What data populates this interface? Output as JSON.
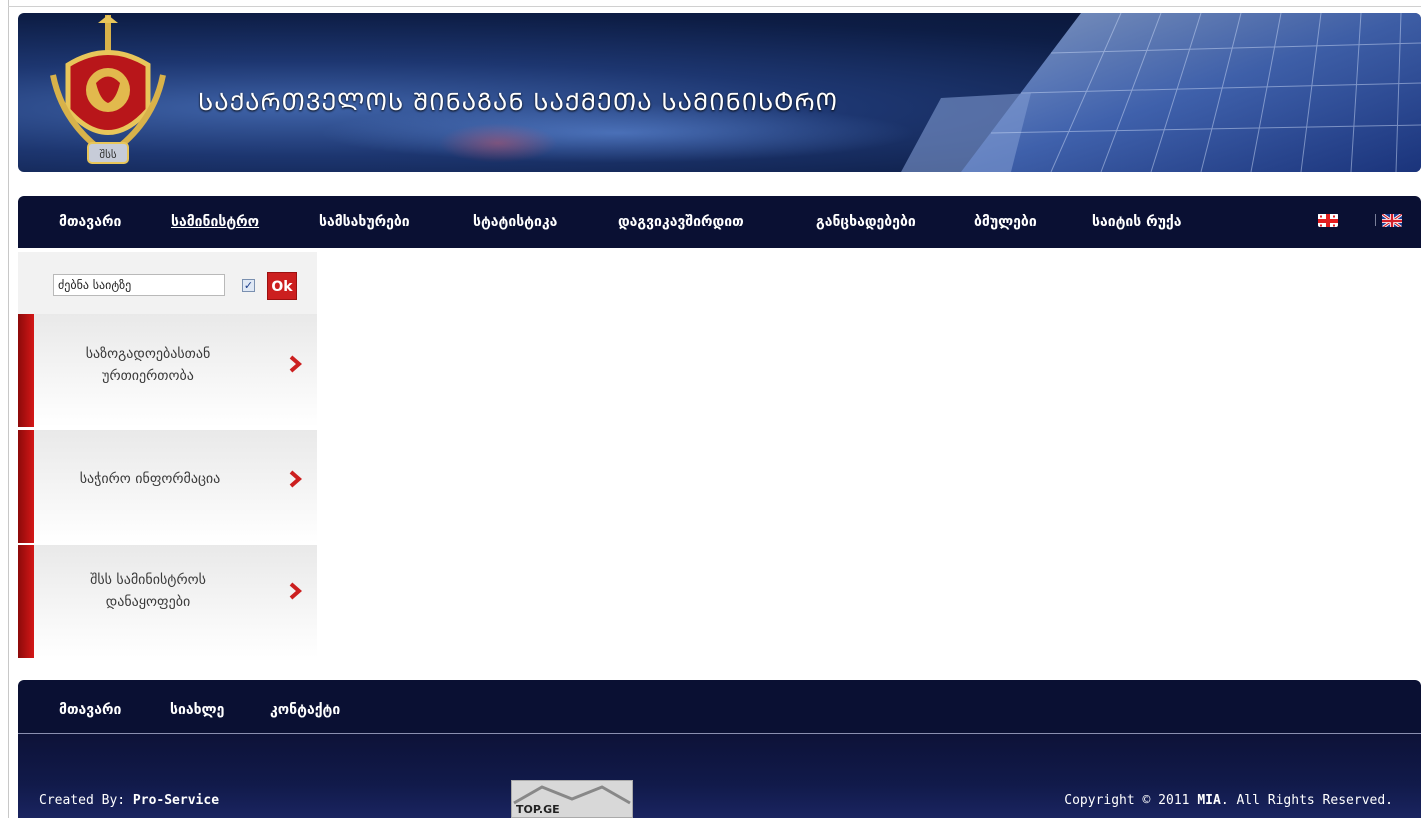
{
  "banner": {
    "title": "ᲡᲐᲥᲐᲠᲗᲕᲔᲚᲝᲡ ᲨᲘᲜᲐᲒᲐᲜ ᲡᲐᲥᲛᲔᲗᲐ ᲡᲐᲛᲘᲜᲘᲡᲢᲠᲝ",
    "emblem_text": "შსს"
  },
  "nav": {
    "items": [
      "მთავარი",
      "სამინისტრო",
      "სამსახურები",
      "სტატისტიკა",
      "დაგვიკავშირდით",
      "განცხადებები",
      "ბმულები",
      "საიტის რუქა"
    ],
    "active_index": 1,
    "languages": [
      "ka",
      "en"
    ]
  },
  "search": {
    "value": "ძებნა საიტზე",
    "checked": true,
    "button_label": "Ok"
  },
  "sidebar": {
    "items": [
      {
        "line1": "საზოგადოებასთან",
        "line2": "ურთიერთობა"
      },
      {
        "line1": "საჭირო ინფორმაცია",
        "line2": ""
      },
      {
        "line1": "შსს სამინისტროს",
        "line2": "დანაყოფები"
      }
    ]
  },
  "footer": {
    "nav": [
      "მთავარი",
      "სიახლე",
      "კონტაქტი"
    ],
    "created_prefix": "Created By: ",
    "created_by": "Pro-Service",
    "copyright_prefix": "Copyright © 2011 ",
    "copyright_org": "MIA",
    "copyright_suffix": ". All Rights Reserved.",
    "counter_label": "TOP.GE"
  },
  "colors": {
    "nav_bg": "#0a1033",
    "accent_red": "#cc1f1f"
  }
}
